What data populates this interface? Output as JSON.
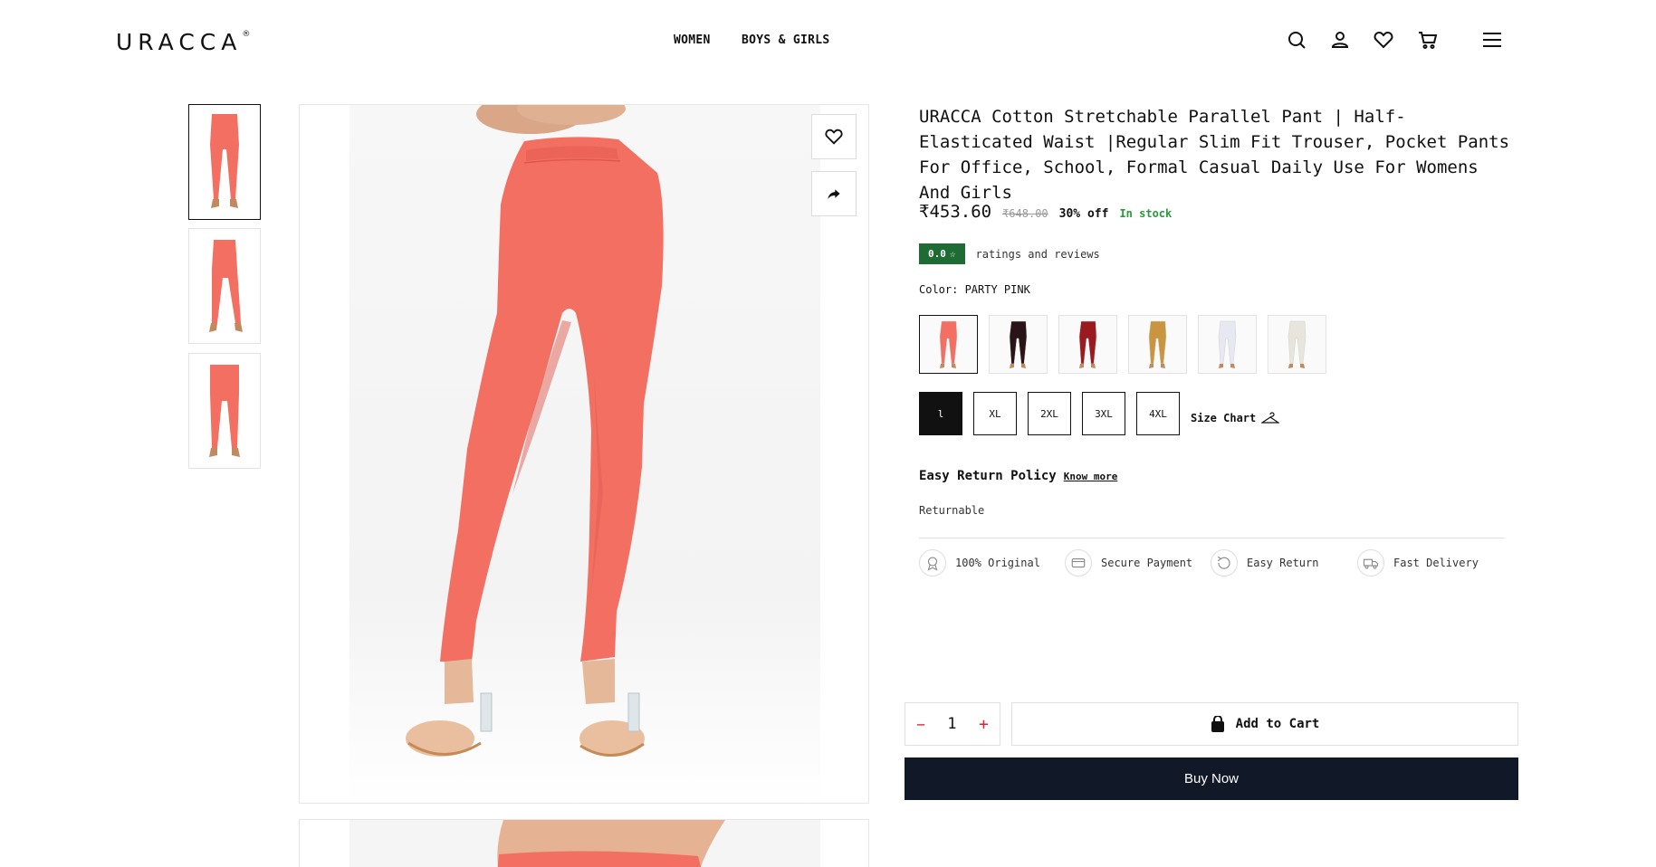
{
  "header": {
    "logo": "URACCA",
    "logo_mark": "®",
    "nav": [
      "WOMEN",
      "BOYS & GIRLS"
    ],
    "icons": [
      "search-icon",
      "user-icon",
      "heart-icon",
      "cart-icon",
      "menu-icon"
    ]
  },
  "gallery": {
    "thumbnails": [
      "PARTY PINK front",
      "PARTY PINK side",
      "PARTY PINK back"
    ],
    "product_color": "#f26f62"
  },
  "product": {
    "title": "URACCA Cotton Stretchable Parallel Pant | Half-Elasticated Waist |Regular Slim Fit Trouser, Pocket Pants For Office, School, Formal Casual Daily Use For Womens And Girls",
    "price": "₹453.60",
    "mrp": "₹648.00",
    "discount": "30% off",
    "stock": "In stock",
    "rating": "0.0",
    "rating_star": "☆",
    "rating_text": "ratings and reviews",
    "color_label": "Color: PARTY PINK",
    "swatch_colors": [
      "#f26f62",
      "#2a1418",
      "#9b1a20",
      "#c9963f",
      "#e8e8f2",
      "#e8e6dc"
    ],
    "sizes": [
      "l",
      "XL",
      "2XL",
      "3XL",
      "4XL"
    ],
    "selected_size": "l",
    "size_chart": "Size Chart",
    "return_policy": "Easy Return Policy",
    "know_more": "Know more",
    "returnable": "Returnable",
    "features": [
      "100% Original",
      "Secure Payment",
      "Easy Return",
      "Fast Delivery"
    ]
  },
  "cart": {
    "minus": "−",
    "qty": "1",
    "plus": "+",
    "add_to_cart": "Add to Cart",
    "buy_now": "Buy Now"
  }
}
